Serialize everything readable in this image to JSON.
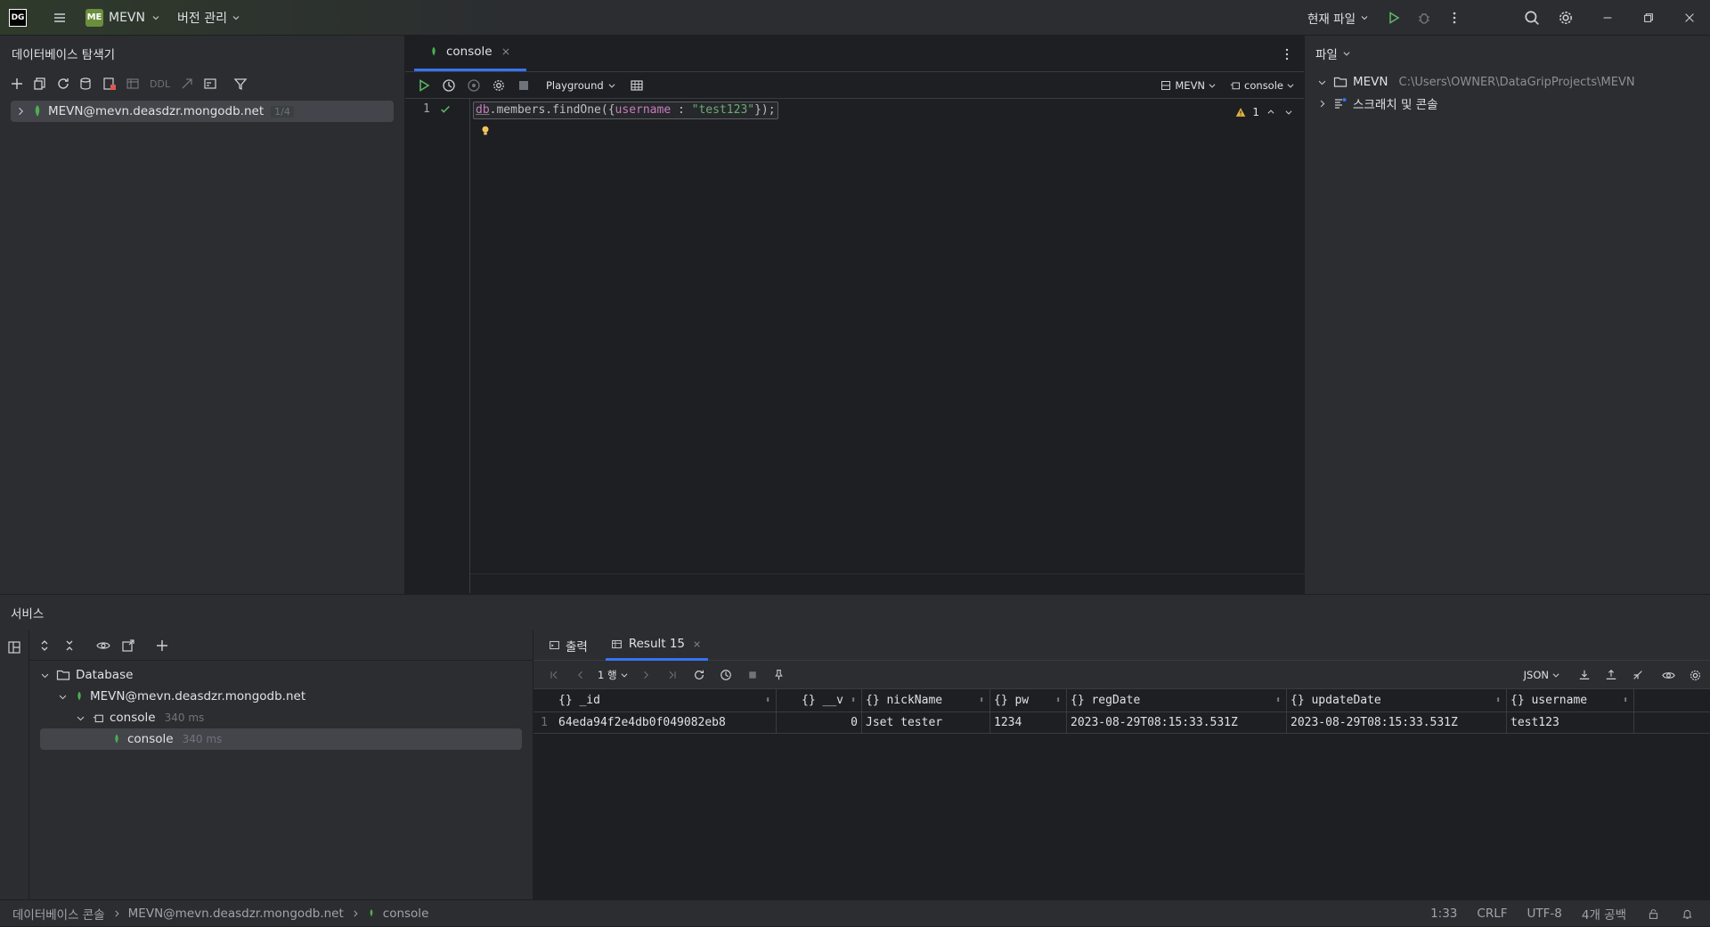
{
  "titlebar": {
    "app_logo": "DG",
    "project_badge": "ME",
    "project_name": "MEVN",
    "vcs_label": "버전 관리",
    "current_file_label": "현재 파일"
  },
  "left_panel": {
    "title": "데이터베이스 탐색기",
    "ddl_label": "DDL",
    "datasource_name": "MEVN@mevn.deasdzr.mongodb.net",
    "datasource_badge": "1/4"
  },
  "editor": {
    "tab_label": "console",
    "playground_label": "Playground",
    "datasource_select": "MEVN",
    "session_select": "console",
    "line_number": "1",
    "code": {
      "obj": "db",
      "call": ".members.findOne({",
      "key": "username",
      "sep": " : ",
      "value": "\"test123\"",
      "end": "});"
    },
    "warning_count": "1"
  },
  "right_panel": {
    "title": "파일",
    "project_name": "MEVN",
    "project_path": "C:\\Users\\OWNER\\DataGripProjects\\MEVN",
    "scratches_label": "스크래치 및 콘솔"
  },
  "services": {
    "title": "서비스",
    "tree": {
      "database_label": "Database",
      "datasource_label": "MEVN@mevn.deasdzr.mongodb.net",
      "console_group_label": "console",
      "console_group_time": "340 ms",
      "console_label": "console",
      "console_time": "340 ms"
    },
    "result": {
      "output_tab": "출력",
      "result_tab": "Result 15",
      "rows_label": "1 행",
      "format_label": "JSON",
      "columns": [
        "{} _id",
        "{} __v",
        "{} nickName",
        "{} pw",
        "{} regDate",
        "{} updateDate",
        "{} username"
      ],
      "rows": [
        {
          "num": "1",
          "cells": [
            "64eda94f2e4db0f049082eb8",
            "0",
            "Jset tester",
            "1234",
            "2023-08-29T08:15:33.531Z",
            "2023-08-29T08:15:33.531Z",
            "test123"
          ]
        }
      ]
    }
  },
  "statusbar": {
    "crumbs": [
      "데이터베이스 콘솔",
      "MEVN@mevn.deasdzr.mongodb.net",
      "console"
    ],
    "position": "1:33",
    "line_sep": "CRLF",
    "encoding": "UTF-8",
    "indent": "4개 공백"
  },
  "colors": {
    "accent": "#3574f0",
    "mongo_leaf": "#4caf50",
    "run_green": "#5fb865",
    "warning": "#e0b441"
  }
}
